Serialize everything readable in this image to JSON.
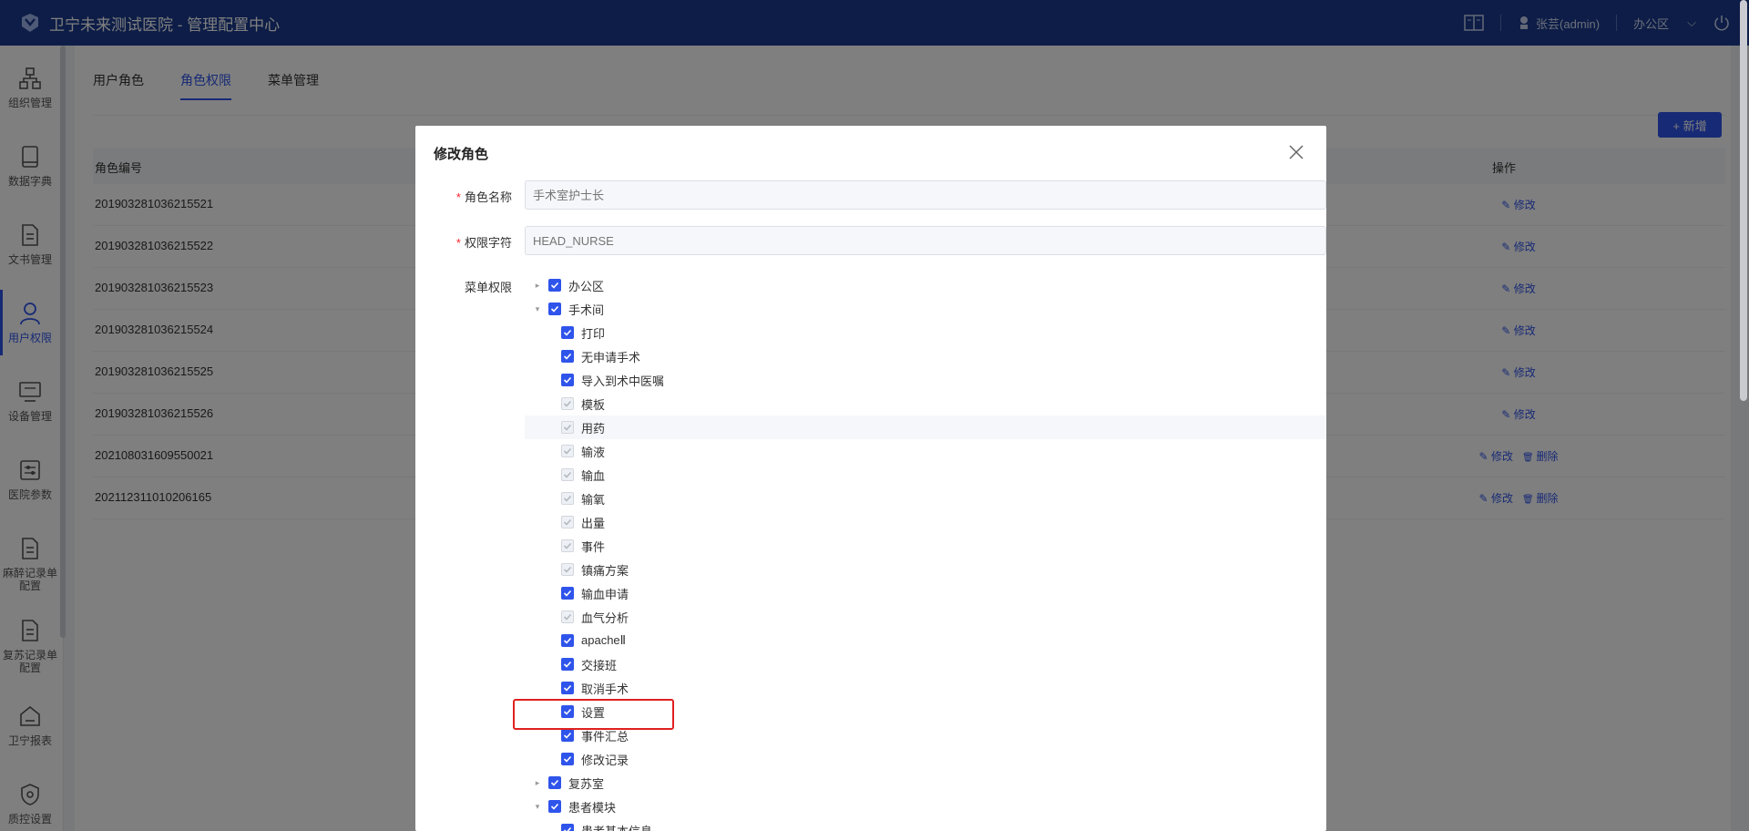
{
  "header": {
    "title": "卫宁未来测试医院 - 管理配置中心",
    "user": "张芸(admin)",
    "workspace": "办公区"
  },
  "sidebar": {
    "items": [
      {
        "label": "组织管理",
        "icon": "org-chart-icon"
      },
      {
        "label": "数据字典",
        "icon": "book-icon"
      },
      {
        "label": "文书管理",
        "icon": "document-icon"
      },
      {
        "label": "用户权限",
        "icon": "user-icon"
      },
      {
        "label": "设备管理",
        "icon": "monitor-icon"
      },
      {
        "label": "医院参数",
        "icon": "sliders-icon"
      },
      {
        "label": "麻醉记录单配置",
        "icon": "document-icon"
      },
      {
        "label": "复苏记录单配置",
        "icon": "document-icon"
      },
      {
        "label": "卫宁报表",
        "icon": "report-icon"
      },
      {
        "label": "质控设置",
        "icon": "shield-icon"
      }
    ]
  },
  "tabs": [
    "用户角色",
    "角色权限",
    "菜单管理"
  ],
  "add_button": "+ 新增",
  "table": {
    "col_code": "角色编号",
    "col_ops": "操作",
    "edit": "修改",
    "delete": "删除",
    "rows": [
      {
        "code": "201903281036215521",
        "deletable": false
      },
      {
        "code": "201903281036215522",
        "deletable": false
      },
      {
        "code": "201903281036215523",
        "deletable": false
      },
      {
        "code": "201903281036215524",
        "deletable": false
      },
      {
        "code": "201903281036215525",
        "deletable": false
      },
      {
        "code": "201903281036215526",
        "deletable": false
      },
      {
        "code": "202108031609550021",
        "deletable": true
      },
      {
        "code": "202112311010206165",
        "deletable": true
      }
    ]
  },
  "modal": {
    "title": "修改角色",
    "role_name_label": "角色名称",
    "role_name_value": "手术室护士长",
    "perm_key_label": "权限字符",
    "perm_key_value": "HEAD_NURSE",
    "menu_perm_label": "菜单权限",
    "tree": [
      {
        "label": "办公区",
        "level": 1,
        "arrow": "collapsed",
        "disabled": false
      },
      {
        "label": "手术间",
        "level": 1,
        "arrow": "expanded",
        "disabled": false
      },
      {
        "label": "打印",
        "level": 2,
        "disabled": false
      },
      {
        "label": "无申请手术",
        "level": 2,
        "disabled": false
      },
      {
        "label": "导入到术中医嘱",
        "level": 2,
        "disabled": false
      },
      {
        "label": "模板",
        "level": 2,
        "disabled": true
      },
      {
        "label": "用药",
        "level": 2,
        "disabled": true,
        "highlight": true
      },
      {
        "label": "输液",
        "level": 2,
        "disabled": true
      },
      {
        "label": "输血",
        "level": 2,
        "disabled": true
      },
      {
        "label": "输氧",
        "level": 2,
        "disabled": true
      },
      {
        "label": "出量",
        "level": 2,
        "disabled": true
      },
      {
        "label": "事件",
        "level": 2,
        "disabled": true
      },
      {
        "label": "镇痛方案",
        "level": 2,
        "disabled": true
      },
      {
        "label": "输血申请",
        "level": 2,
        "disabled": false
      },
      {
        "label": "血气分析",
        "level": 2,
        "disabled": true
      },
      {
        "label": "apacheⅡ",
        "level": 2,
        "disabled": false
      },
      {
        "label": "交接班",
        "level": 2,
        "disabled": false
      },
      {
        "label": "取消手术",
        "level": 2,
        "disabled": false
      },
      {
        "label": "设置",
        "level": 2,
        "disabled": false
      },
      {
        "label": "事件汇总",
        "level": 2,
        "disabled": false
      },
      {
        "label": "修改记录",
        "level": 2,
        "disabled": false
      },
      {
        "label": "复苏室",
        "level": 1,
        "arrow": "collapsed",
        "disabled": false
      },
      {
        "label": "患者模块",
        "level": 1,
        "arrow": "expanded",
        "disabled": false
      },
      {
        "label": "患者基本信息",
        "level": 2,
        "disabled": false
      }
    ]
  },
  "colors": {
    "primary": "#2f54eb",
    "header": "#1a3a8f",
    "highlight": "#e02020"
  }
}
